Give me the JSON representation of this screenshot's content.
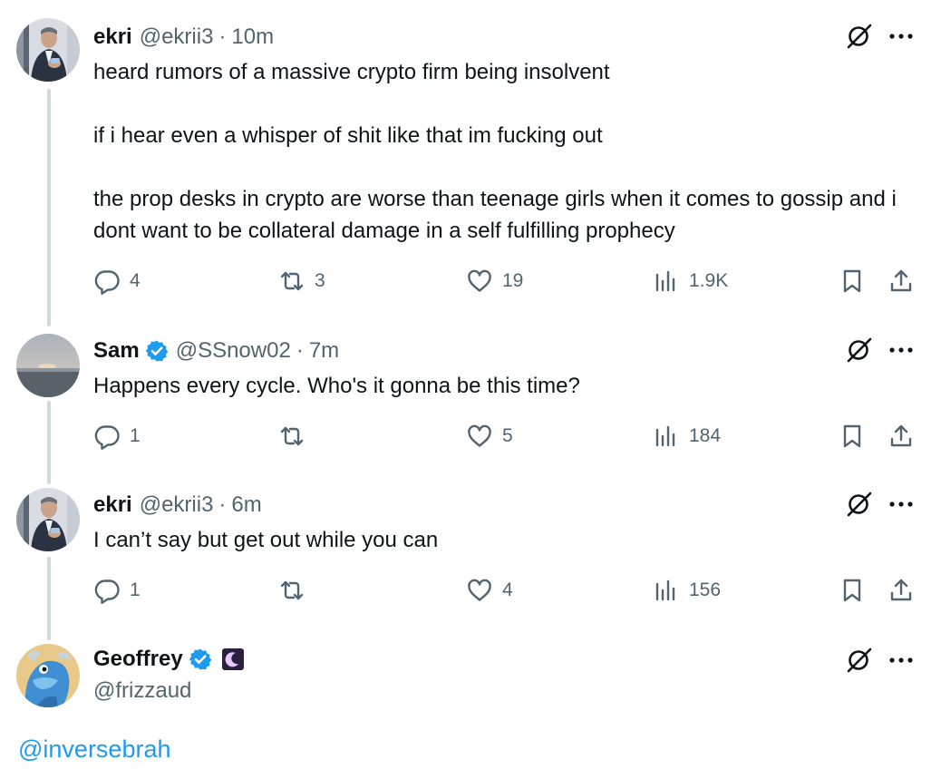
{
  "tweets": [
    {
      "name": "ekri",
      "handle": "@ekrii3",
      "sep": "·",
      "time": "10m",
      "text": "heard rumors of a massive crypto firm being insolvent\n\nif i hear even a whisper of shit like that im fucking out\n\nthe prop desks in crypto are worse than teenage girls when it comes to gossip and i dont want to be collateral damage in a self fulfilling prophecy",
      "replies": "4",
      "reposts": "3",
      "likes": "19",
      "views": "1.9K"
    },
    {
      "name": "Sam",
      "handle": "@SSnow02",
      "sep": "·",
      "time": "7m",
      "text": "Happens every cycle. Who's it gonna be this time?",
      "replies": "1",
      "reposts": "",
      "likes": "5",
      "views": "184"
    },
    {
      "name": "ekri",
      "handle": "@ekrii3",
      "sep": "·",
      "time": "6m",
      "text": "I can’t say but get out while you can",
      "replies": "1",
      "reposts": "",
      "likes": "4",
      "views": "156"
    }
  ],
  "focused": {
    "name": "Geoffrey",
    "handle": "@frizzaud",
    "text": "@inversebrah"
  },
  "colors": {
    "accent": "#1d9bf0",
    "muted": "#536471",
    "thread_line": "#cfd9de",
    "text": "#0f1419"
  },
  "icons": [
    "reply-icon",
    "repost-icon",
    "like-icon",
    "views-icon",
    "bookmark-icon",
    "share-icon",
    "grok-icon",
    "more-icon",
    "verified-icon",
    "moon-badge-icon"
  ]
}
